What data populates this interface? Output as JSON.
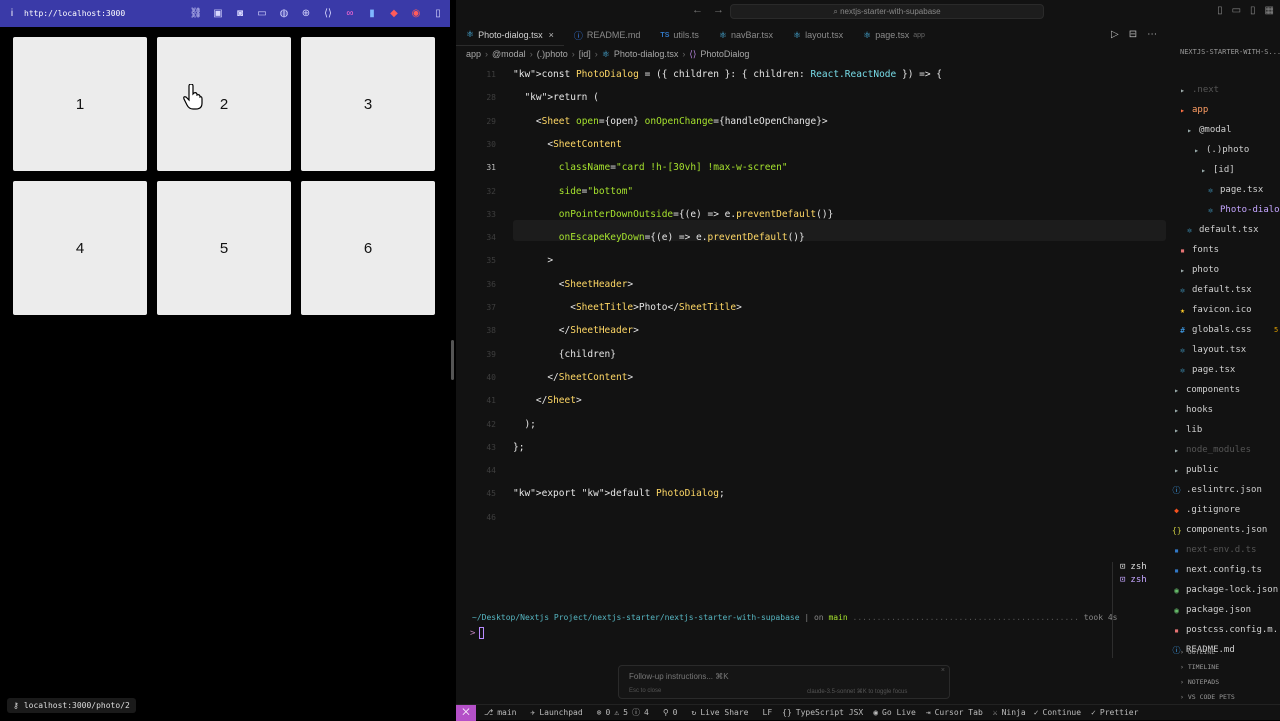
{
  "browser": {
    "info_icon": "i",
    "url": "http://localhost:3000",
    "tiles": [
      "1",
      "2",
      "3",
      "4",
      "5",
      "6"
    ],
    "status_url": "localhost:3000/photo/2"
  },
  "editor": {
    "search_text": "nextjs-starter-with-supabase",
    "tabs": [
      {
        "label": "Photo-dialog.tsx",
        "icon": "react",
        "active": true
      },
      {
        "label": "README.md",
        "icon": "info"
      },
      {
        "label": "utils.ts",
        "icon": "ts"
      },
      {
        "label": "navBar.tsx",
        "icon": "react"
      },
      {
        "label": "layout.tsx",
        "icon": "react"
      },
      {
        "label": "page.tsx",
        "icon": "react",
        "hint": "app"
      }
    ],
    "breadcrumb": [
      "app",
      "@modal",
      "(.)photo",
      "[id]",
      "Photo-dialog.tsx",
      "PhotoDialog"
    ],
    "line_numbers": [
      "11",
      "28",
      "29",
      "30",
      "31",
      "32",
      "33",
      "34",
      "35",
      "36",
      "37",
      "38",
      "39",
      "40",
      "41",
      "42",
      "43",
      "44",
      "45",
      "46"
    ],
    "current_line": "31",
    "terminal": {
      "path": "~/Desktop/Nextjs Project/nextjs-starter/nextjs-starter-with-supabase",
      "on": "on",
      "branch": "main",
      "dots": "...............................................",
      "took": "took 4s",
      "prompt": ">",
      "shells": [
        "zsh",
        "zsh"
      ]
    },
    "chat": {
      "placeholder": "Follow-up instructions... ⌘K",
      "hint_left": "Esc to close",
      "hint_right": "claude-3.5-sonnet   ⌘K to toggle focus"
    },
    "explorer": {
      "title": "NEXTJS-STARTER-WITH-S...",
      "items": [
        {
          "label": ".next",
          "icon": "folder",
          "indent": 0,
          "dim": true
        },
        {
          "label": "app",
          "icon": "folder",
          "indent": 0,
          "color": "orange"
        },
        {
          "label": "@modal",
          "icon": "folder",
          "indent": 1
        },
        {
          "label": "(.)photo",
          "icon": "folder",
          "indent": 2
        },
        {
          "label": "[id]",
          "icon": "folder",
          "indent": 3
        },
        {
          "label": "page.tsx",
          "icon": "react",
          "indent": 4
        },
        {
          "label": "Photo-dialog...",
          "icon": "react",
          "indent": 4,
          "selected": true
        },
        {
          "label": "default.tsx",
          "icon": "react",
          "indent": 1
        },
        {
          "label": "fonts",
          "icon": "red",
          "indent": 0
        },
        {
          "label": "photo",
          "icon": "folder",
          "indent": 0
        },
        {
          "label": "default.tsx",
          "icon": "react",
          "indent": 0
        },
        {
          "label": "favicon.ico",
          "icon": "star",
          "indent": 0
        },
        {
          "label": "globals.css",
          "icon": "css",
          "indent": 0,
          "badge": "5"
        },
        {
          "label": "layout.tsx",
          "icon": "react",
          "indent": 0
        },
        {
          "label": "page.tsx",
          "icon": "react",
          "indent": 0
        },
        {
          "label": "components",
          "icon": "folder",
          "indent": -1
        },
        {
          "label": "hooks",
          "icon": "folder",
          "indent": -1
        },
        {
          "label": "lib",
          "icon": "folder",
          "indent": -1
        },
        {
          "label": "node_modules",
          "icon": "folder",
          "indent": -1,
          "dim": true
        },
        {
          "label": "public",
          "icon": "folder",
          "indent": -1
        },
        {
          "label": ".eslintrc.json",
          "icon": "info",
          "indent": -1
        },
        {
          "label": ".gitignore",
          "icon": "git",
          "indent": -1
        },
        {
          "label": "components.json",
          "icon": "json",
          "indent": -1
        },
        {
          "label": "next-env.d.ts",
          "icon": "ts",
          "indent": -1,
          "dim": true
        },
        {
          "label": "next.config.ts",
          "icon": "ts",
          "indent": -1
        },
        {
          "label": "package-lock.json",
          "icon": "green",
          "indent": -1
        },
        {
          "label": "package.json",
          "icon": "green",
          "indent": -1
        },
        {
          "label": "postcss.config.m...",
          "icon": "red",
          "indent": -1
        },
        {
          "label": "README.md",
          "icon": "info",
          "indent": -1
        }
      ],
      "sections": [
        "OUTLINE",
        "TIMELINE",
        "NOTEPADS",
        "VS CODE PETS"
      ]
    },
    "statusbar": {
      "remote": "⨉",
      "branch": "main",
      "launchpad": "Launchpad",
      "errors": "0",
      "warnings": "5",
      "infos": "4",
      "ports": "0",
      "live_share": "Live Share",
      "eol": "LF",
      "language": "TypeScript JSX",
      "go_live": "Go Live",
      "cursor_tab": "Cursor Tab",
      "ninja": "Ninja",
      "continue": "Continue",
      "prettier": "Prettier"
    }
  },
  "code_lines": [
    "const PhotoDialog = ({ children }: { children: React.ReactNode }) => {",
    "  return (",
    "    <Sheet open={open} onOpenChange={handleOpenChange}>",
    "      <SheetContent",
    "        className=\"card !h-[30vh] !max-w-screen\"",
    "        side=\"bottom\"",
    "        onPointerDownOutside={(e) => e.preventDefault()}",
    "        onEscapeKeyDown={(e) => e.preventDefault()}",
    "      >",
    "        <SheetHeader>",
    "          <SheetTitle>Photo</SheetTitle>",
    "        </SheetHeader>",
    "        {children}",
    "      </SheetContent>",
    "    </Sheet>",
    "  );",
    "};",
    "",
    "export default PhotoDialog;",
    ""
  ]
}
